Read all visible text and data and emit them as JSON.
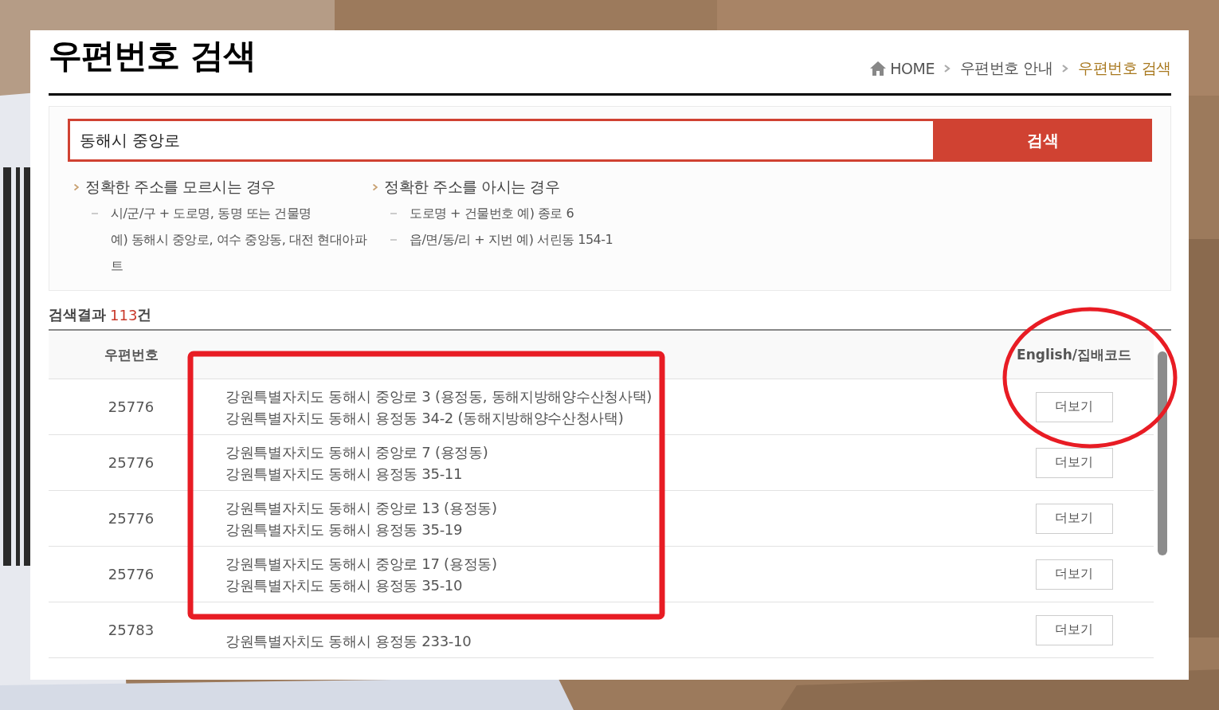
{
  "page": {
    "title": "우편번호 검색"
  },
  "breadcrumb": [
    {
      "label": "HOME",
      "kind": "home",
      "current": false
    },
    {
      "label": "우편번호 안내",
      "kind": "link",
      "current": false
    },
    {
      "label": "우편번호 검색",
      "kind": "link",
      "current": true
    }
  ],
  "search": {
    "value": "동해시 중앙로",
    "button": "검색"
  },
  "guides": [
    {
      "heading": "정확한 주소를 모르시는 경우",
      "items": [
        "시/군/구 + 도로명, 동명 또는 건물명\n예) 동해시 중앙로, 여수 중앙동, 대전 현대아파\n트"
      ]
    },
    {
      "heading": "정확한 주소를 아시는 경우",
      "items": [
        "도로명 + 건물번호 예) 종로 6",
        "읍/면/동/리 + 지번 예) 서린동 154-1"
      ]
    }
  ],
  "results": {
    "label": "검색결과",
    "count": "113",
    "suffix": "건"
  },
  "table": {
    "header": {
      "postal_code": "우편번호",
      "column_3": "English/집배코드"
    },
    "rows": [
      {
        "postal_code": "25776",
        "road_address": "강원특별자치도 동해시 중앙로 3 (용정동, 동해지방해양수산청사택)",
        "lot_address": "강원특별자치도 동해시 용정동 34-2 (동해지방해양수산청사택)",
        "button": "더보기"
      },
      {
        "postal_code": "25776",
        "road_address": "강원특별자치도 동해시 중앙로 7 (용정동)",
        "lot_address": "강원특별자치도 동해시 용정동 35-11",
        "button": "더보기"
      },
      {
        "postal_code": "25776",
        "road_address": "강원특별자치도 동해시 중앙로 13 (용정동)",
        "lot_address": "강원특별자치도 동해시 용정동 35-19",
        "button": "더보기"
      },
      {
        "postal_code": "25776",
        "road_address": "강원특별자치도 동해시 중앙로 17 (용정동)",
        "lot_address": "강원특별자치도 동해시 용정동 35-10",
        "button": "더보기"
      },
      {
        "postal_code": "25783",
        "lot_address": "강원특별자치도 동해시 용정동 233-10",
        "button": "더보기"
      }
    ]
  },
  "annotations": [
    {
      "kind": "rectangle"
    },
    {
      "kind": "ellipse"
    }
  ]
}
